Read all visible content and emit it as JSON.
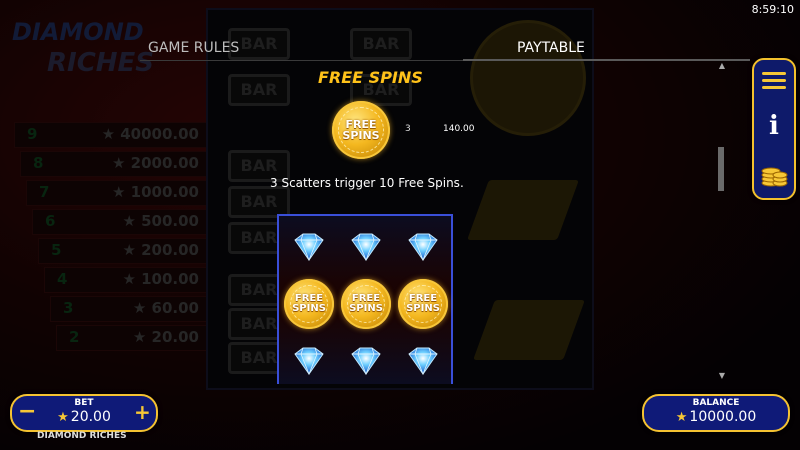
{
  "clock": "8:59:10",
  "tabs": {
    "rules": "GAME RULES",
    "paytable": "PAYTABLE"
  },
  "section": {
    "title": "FREE SPINS"
  },
  "scatter_symbol": {
    "label_line1": "FREE",
    "label_line2": "SPINS",
    "count": "3",
    "payout": "140.00"
  },
  "description": "3 Scatters trigger 10 Free Spins.",
  "example_grid": {
    "rows": [
      [
        "diamond",
        "diamond",
        "diamond"
      ],
      [
        "free-spins",
        "free-spins",
        "free-spins"
      ],
      [
        "diamond",
        "diamond",
        "diamond"
      ]
    ],
    "coin_line1": "FREE",
    "coin_line2": "SPINS"
  },
  "background": {
    "logo_line1": "DIAMOND",
    "logo_line2": "RICHES",
    "bar_label": "BAR",
    "paytable": [
      {
        "n": "9",
        "v": "40000.00"
      },
      {
        "n": "8",
        "v": "2000.00"
      },
      {
        "n": "7",
        "v": "1000.00"
      },
      {
        "n": "6",
        "v": "500.00"
      },
      {
        "n": "5",
        "v": "200.00"
      },
      {
        "n": "4",
        "v": "100.00"
      },
      {
        "n": "3",
        "v": "60.00"
      },
      {
        "n": "2",
        "v": "20.00"
      }
    ]
  },
  "bet": {
    "label": "BET",
    "value": "20.00",
    "minus": "−",
    "plus": "+"
  },
  "balance": {
    "label": "BALANCE",
    "value": "10000.00"
  },
  "game_name": "DIAMOND RICHES",
  "colors": {
    "accent_gold": "#ffc21a",
    "panel_blue": "#0f1a78",
    "grid_border": "#3a4fd8"
  }
}
